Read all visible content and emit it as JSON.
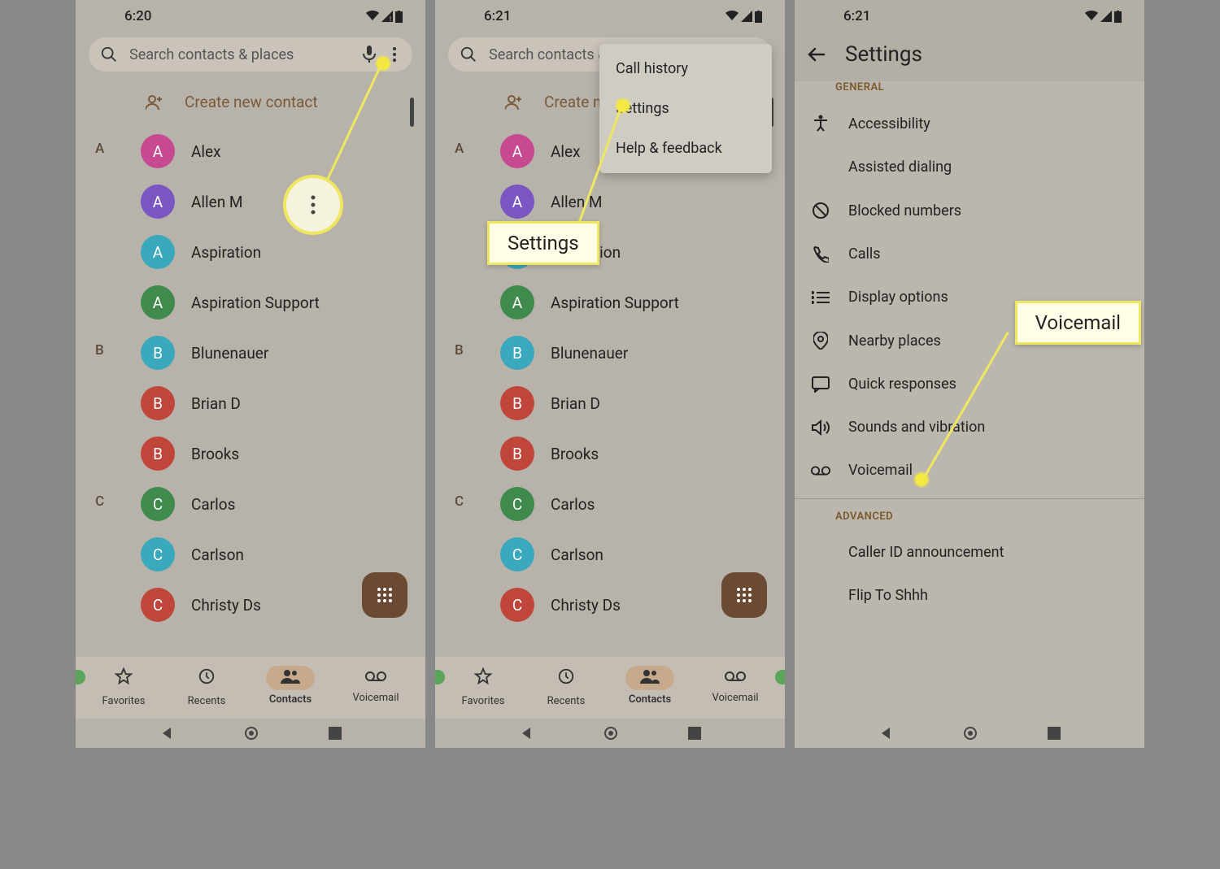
{
  "status": {
    "time1": "6:20",
    "time2": "6:21",
    "time3": "6:21"
  },
  "search": {
    "placeholder": "Search contacts & places"
  },
  "createContact": "Create new contact",
  "contacts": {
    "A": [
      {
        "name": "Alex",
        "initial": "A",
        "color": "#c74992"
      },
      {
        "name": "Allen M",
        "initial": "A",
        "color": "#7a56c2"
      },
      {
        "name": "Aspiration",
        "initial": "A",
        "color": "#3aa8bd"
      },
      {
        "name": "Aspiration Support",
        "initial": "A",
        "color": "#3f8a4c"
      }
    ],
    "B": [
      {
        "name": "Blunenauer",
        "initial": "B",
        "color": "#3aa8bd"
      },
      {
        "name": "Brian D",
        "initial": "B",
        "color": "#c0453b"
      },
      {
        "name": "Brooks",
        "initial": "B",
        "color": "#c0453b"
      }
    ],
    "C": [
      {
        "name": "Carlos",
        "initial": "C",
        "color": "#3f8a4c"
      },
      {
        "name": "Carlson",
        "initial": "C",
        "color": "#3aa8bd"
      },
      {
        "name": "Christy Ds",
        "initial": "C",
        "color": "#c0453b"
      }
    ]
  },
  "nav": {
    "favorites": "Favorites",
    "recents": "Recents",
    "contacts": "Contacts",
    "voicemail": "Voicemail"
  },
  "menu": {
    "callHistory": "Call history",
    "settings": "Settings",
    "help": "Help & feedback"
  },
  "callouts": {
    "settings": "Settings",
    "voicemail": "Voicemail"
  },
  "settings": {
    "title": "Settings",
    "general": "GENERAL",
    "accessibility": "Accessibility",
    "assisted": "Assisted dialing",
    "blocked": "Blocked numbers",
    "calls": "Calls",
    "display": "Display options",
    "nearby": "Nearby places",
    "quick": "Quick responses",
    "sounds": "Sounds and vibration",
    "voicemail": "Voicemail",
    "advanced": "ADVANCED",
    "callerId": "Caller ID announcement",
    "flip": "Flip To Shhh"
  }
}
